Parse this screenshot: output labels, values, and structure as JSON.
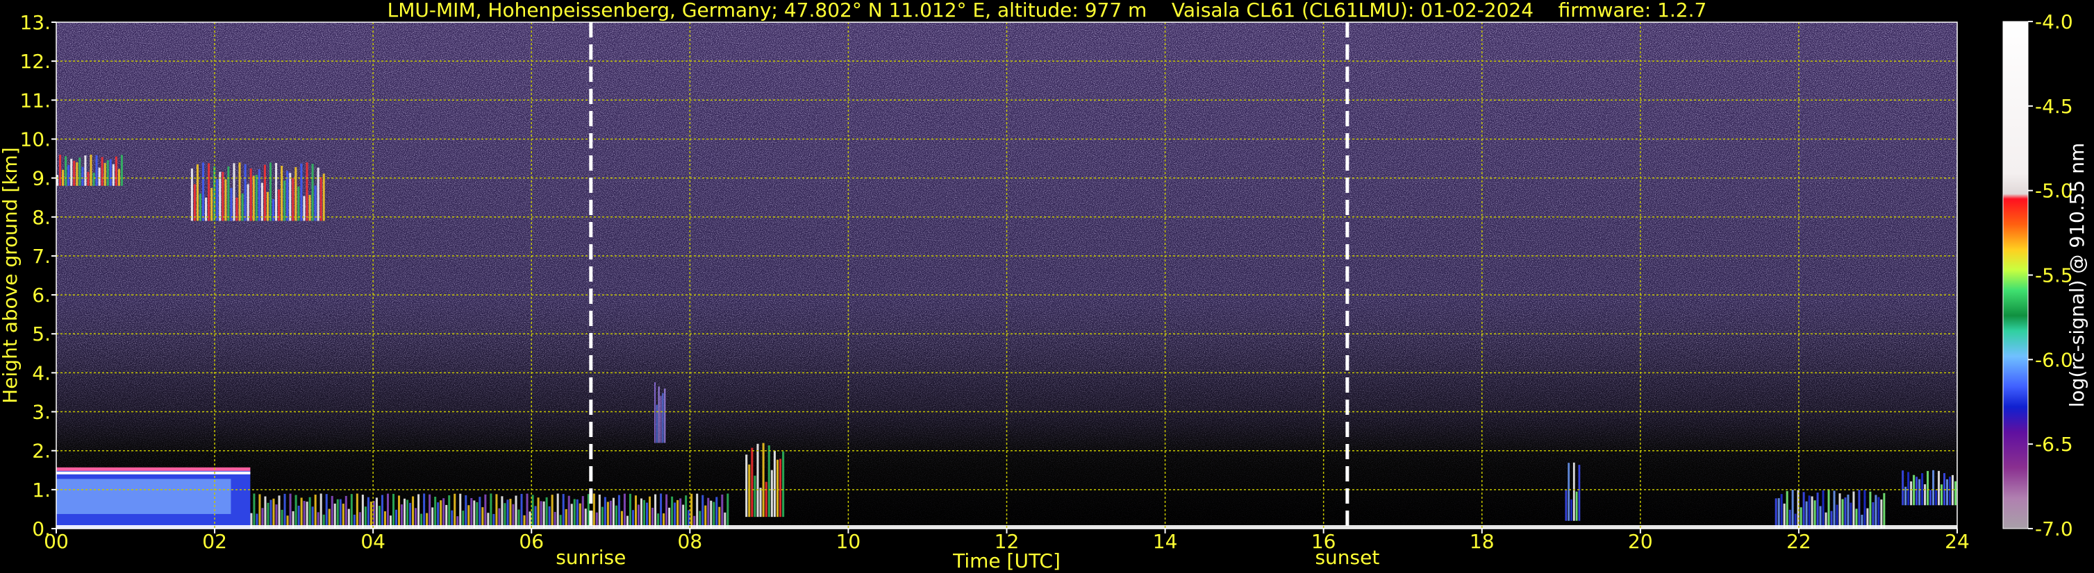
{
  "chart_data": {
    "type": "heatmap",
    "title": "LMU-MIM, Hohenpeissenberg, Germany; 47.802° N 11.012° E, altitude: 977 m    Vaisala CL61 (CL61LMU): 01-02-2024    firmware: 1.2.7",
    "xlabel": "Time [UTC]",
    "ylabel": "Height above ground [km]",
    "xlim": [
      0,
      24
    ],
    "ylim": [
      0,
      13
    ],
    "x_ticks": [
      "00",
      "02",
      "04",
      "06",
      "08",
      "10",
      "12",
      "14",
      "16",
      "18",
      "20",
      "22",
      "24"
    ],
    "y_ticks": [
      "0.",
      "1.",
      "2.",
      "3.",
      "4.",
      "5.",
      "6.",
      "7.",
      "8.",
      "9.",
      "10.",
      "11.",
      "12.",
      "13."
    ],
    "grid": true,
    "markers": [
      {
        "label": "sunrise",
        "time": 6.75
      },
      {
        "label": "sunset",
        "time": 16.3
      }
    ],
    "colorbar": {
      "label": "log(rc-signal) @ 910.55 nm",
      "range": [
        -7.0,
        -4.0
      ],
      "ticks": [
        "-4.0",
        "-4.5",
        "-5.0",
        "-5.5",
        "-6.0",
        "-6.5",
        "-7.0"
      ],
      "tick_values": [
        -4.0,
        -4.5,
        -5.0,
        -5.5,
        -6.0,
        -6.5,
        -7.0
      ]
    },
    "features": [
      {
        "kind": "cirrus",
        "t_start": 0.0,
        "t_end": 0.85,
        "h_bottom": 8.8,
        "h_top": 9.6
      },
      {
        "kind": "cirrus",
        "t_start": 1.7,
        "t_end": 3.4,
        "h_bottom": 7.9,
        "h_top": 9.4
      },
      {
        "kind": "low-cloud",
        "t_start": 0.0,
        "t_end": 2.45,
        "h_bottom": 0.0,
        "h_top": 1.5
      },
      {
        "kind": "boundary-layer",
        "t_start": 2.45,
        "t_end": 8.5,
        "h_bottom": 0.0,
        "h_top": 0.9
      },
      {
        "kind": "convective-plume",
        "t_start": 8.7,
        "t_end": 9.2,
        "h_bottom": 0.3,
        "h_top": 2.2
      },
      {
        "kind": "aerosol",
        "t_start": 7.55,
        "t_end": 7.7,
        "h_bottom": 2.2,
        "h_top": 3.8
      },
      {
        "kind": "low-cloud",
        "t_start": 19.05,
        "t_end": 19.25,
        "h_bottom": 0.2,
        "h_top": 1.7
      },
      {
        "kind": "low-cloud",
        "t_start": 21.7,
        "t_end": 23.1,
        "h_bottom": 0.0,
        "h_top": 1.0
      },
      {
        "kind": "low-cloud",
        "t_start": 23.3,
        "t_end": 24.0,
        "h_bottom": 0.6,
        "h_top": 1.5
      }
    ]
  }
}
